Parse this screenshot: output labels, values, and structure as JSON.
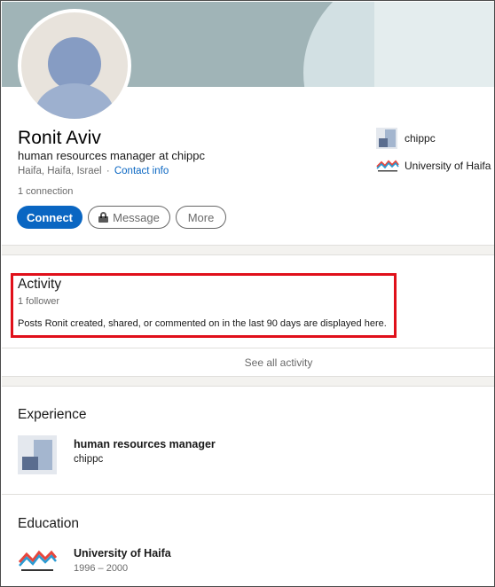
{
  "profile": {
    "name": "Ronit Aviv",
    "headline": "human resources manager at chippc",
    "location": "Haifa, Haifa, Israel",
    "separator": "·",
    "contact_info_label": "Contact info",
    "connections": "1 connection"
  },
  "actions": {
    "connect_label": "Connect",
    "message_label": "Message",
    "more_label": "More"
  },
  "top_card_orgs": [
    {
      "name": "chippc",
      "icon": "chippc-logo-icon"
    },
    {
      "name": "University of Haifa",
      "icon": "university-of-haifa-logo-icon"
    }
  ],
  "activity": {
    "title": "Activity",
    "followers": "1 follower",
    "description": "Posts Ronit created, shared, or commented on in the last 90 days are displayed here.",
    "see_all_label": "See all activity",
    "highlight_color": "#e0101a"
  },
  "experience": {
    "title": "Experience",
    "items": [
      {
        "role": "human resources manager",
        "company": "chippc",
        "icon": "chippc-logo-icon"
      }
    ]
  },
  "education": {
    "title": "Education",
    "items": [
      {
        "school": "University of Haifa",
        "years": "1996 – 2000",
        "icon": "university-of-haifa-logo-icon"
      }
    ]
  },
  "colors": {
    "accent": "#0a66c2",
    "banner": "#a0b4b7",
    "page_divider": "#f3f2ef"
  }
}
